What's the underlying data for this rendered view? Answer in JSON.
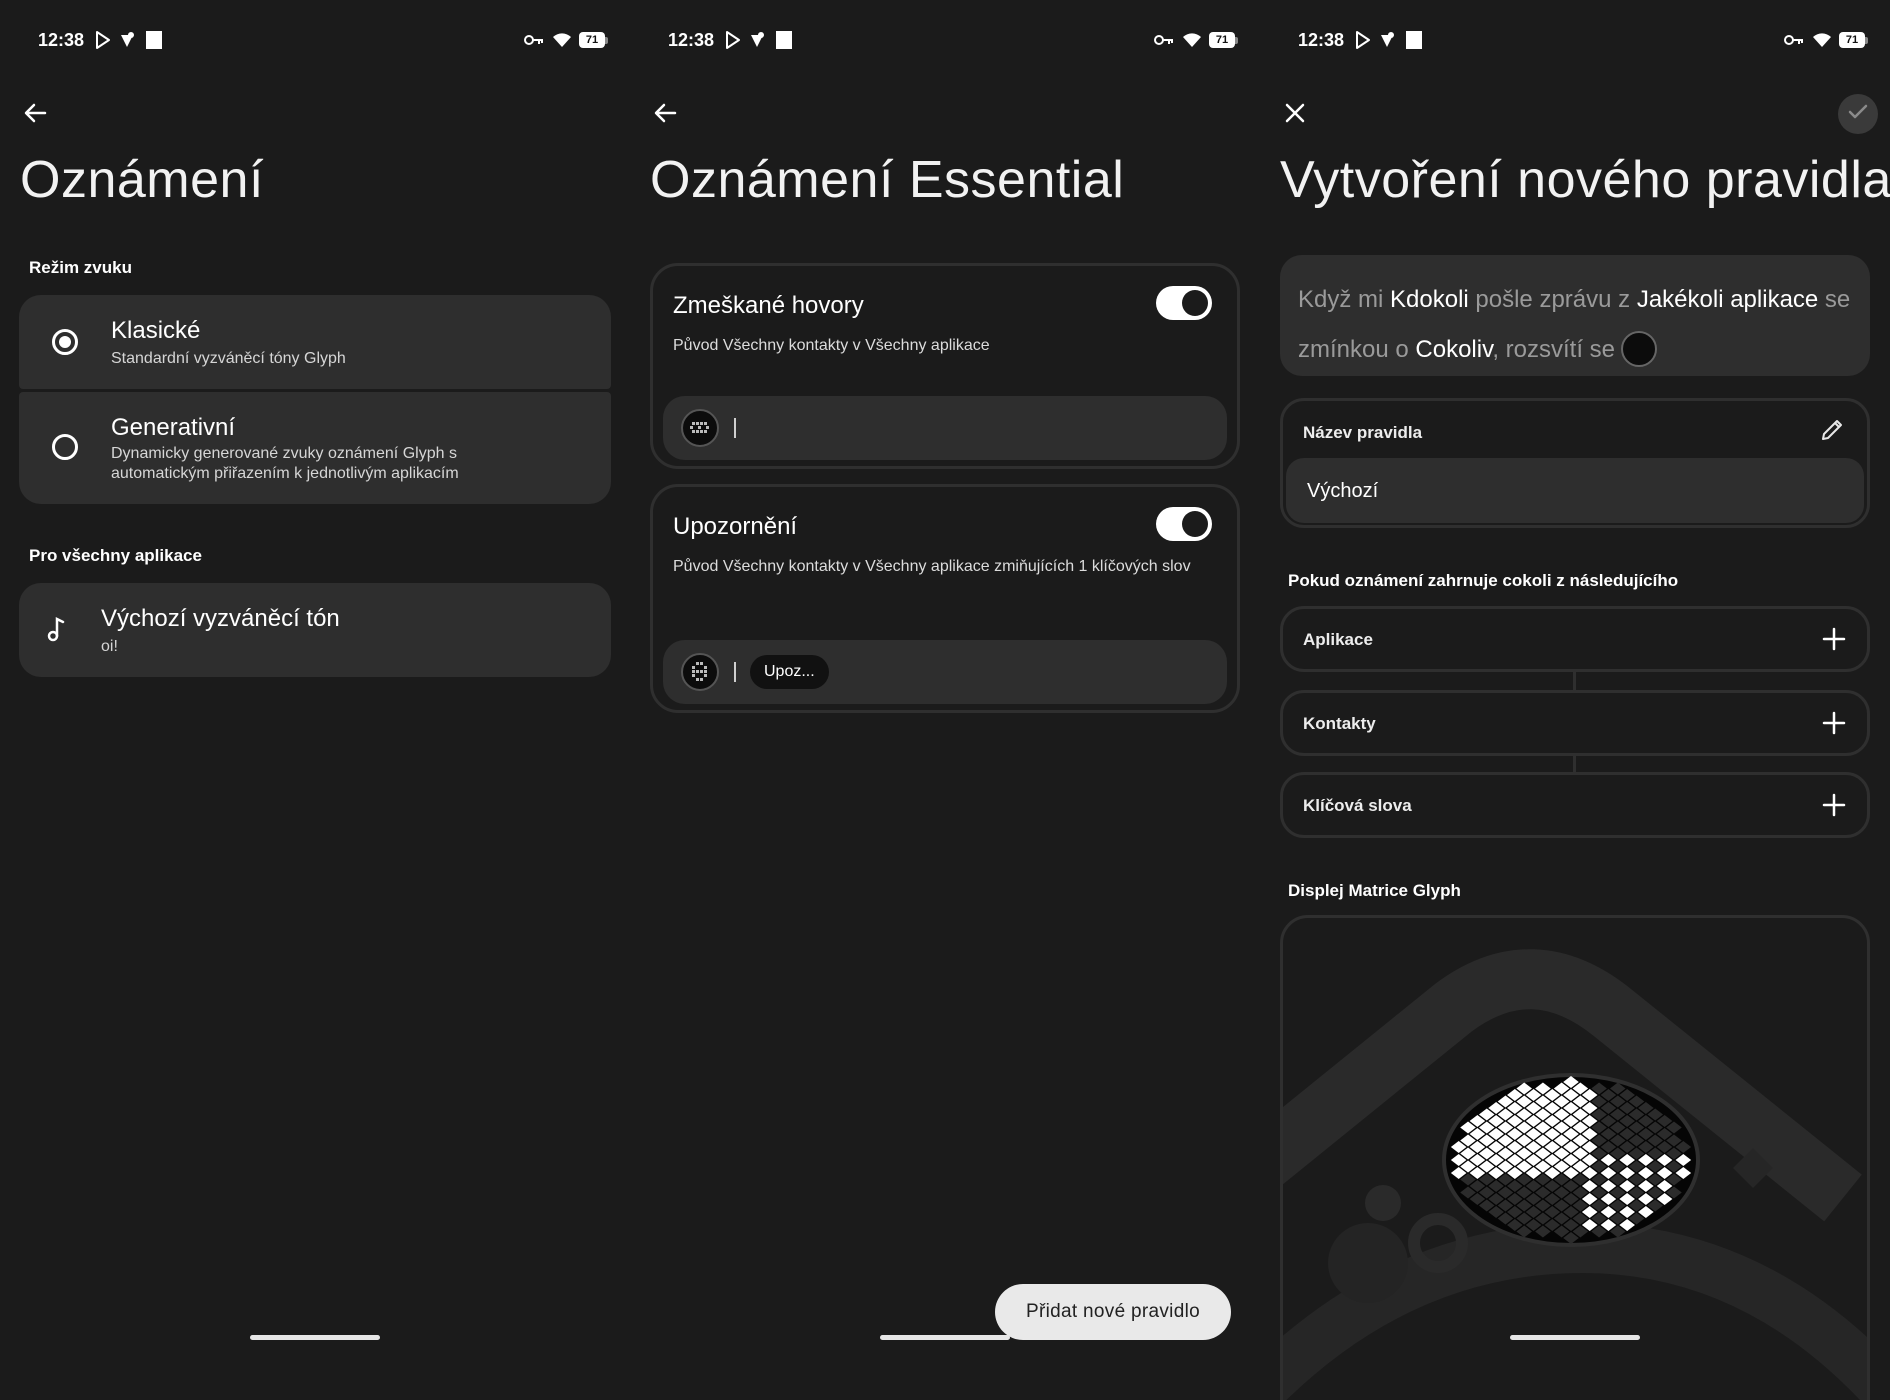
{
  "status": {
    "time": "12:38",
    "battery": "71"
  },
  "screen1": {
    "title": "Oznámení",
    "sound_mode_label": "Režim zvuku",
    "options": [
      {
        "title": "Klasické",
        "subtitle": "Standardní vyzváněcí tóny Glyph",
        "selected": true
      },
      {
        "title": "Generativní",
        "subtitle": "Dynamicky generované zvuky oznámení Glyph s automatickým přiřazením k jednotlivým aplikacím",
        "selected": false
      }
    ],
    "all_apps_label": "Pro všechny aplikace",
    "ringtone": {
      "title": "Výchozí vyzváněcí tón",
      "subtitle": "oi!"
    }
  },
  "screen2": {
    "title": "Oznámení Essential",
    "rules": [
      {
        "title": "Zmeškané hovory",
        "description": "Původ Všechny kontakty v Všechny aplikace",
        "enabled": true,
        "chip": ""
      },
      {
        "title": "Upozornění",
        "description": "Původ Všechny kontakty v Všechny aplikace zmiňujících 1 klíčových slov",
        "enabled": true,
        "chip": "Upoz..."
      }
    ],
    "add_button": "Přidat nové pravidlo"
  },
  "screen3": {
    "title": "Vytvoření nového pravidla",
    "sentence": {
      "p1": "Když mi ",
      "who": "Kdokoli",
      "p2": " pošle zprávu z ",
      "app": "Jakékoli aplikace",
      "p3": " se zmínkou o ",
      "keyword": "Cokoliv",
      "p4": ", rozsvítí se"
    },
    "name_label": "Název pravidla",
    "name_value": "Výchozí",
    "conditions_label": "Pokud oznámení zahrnuje cokoli z následujícího",
    "conditions": [
      "Aplikace",
      "Kontakty",
      "Klíčová slova"
    ],
    "matrix_label": "Displej Matrice Glyph"
  },
  "colors": {
    "background": "#1b1b1b",
    "surface": "#2e2e2e",
    "border": "#2f2f2f",
    "text": "#ffffff",
    "muted": "#9a9a9a"
  },
  "icons": [
    "back-arrow-icon",
    "close-icon",
    "check-icon",
    "music-note-icon",
    "edit-pencil-icon",
    "plus-icon",
    "wifi-icon",
    "vpn-key-icon",
    "play-store-icon",
    "glyph-matrix-icon"
  ]
}
